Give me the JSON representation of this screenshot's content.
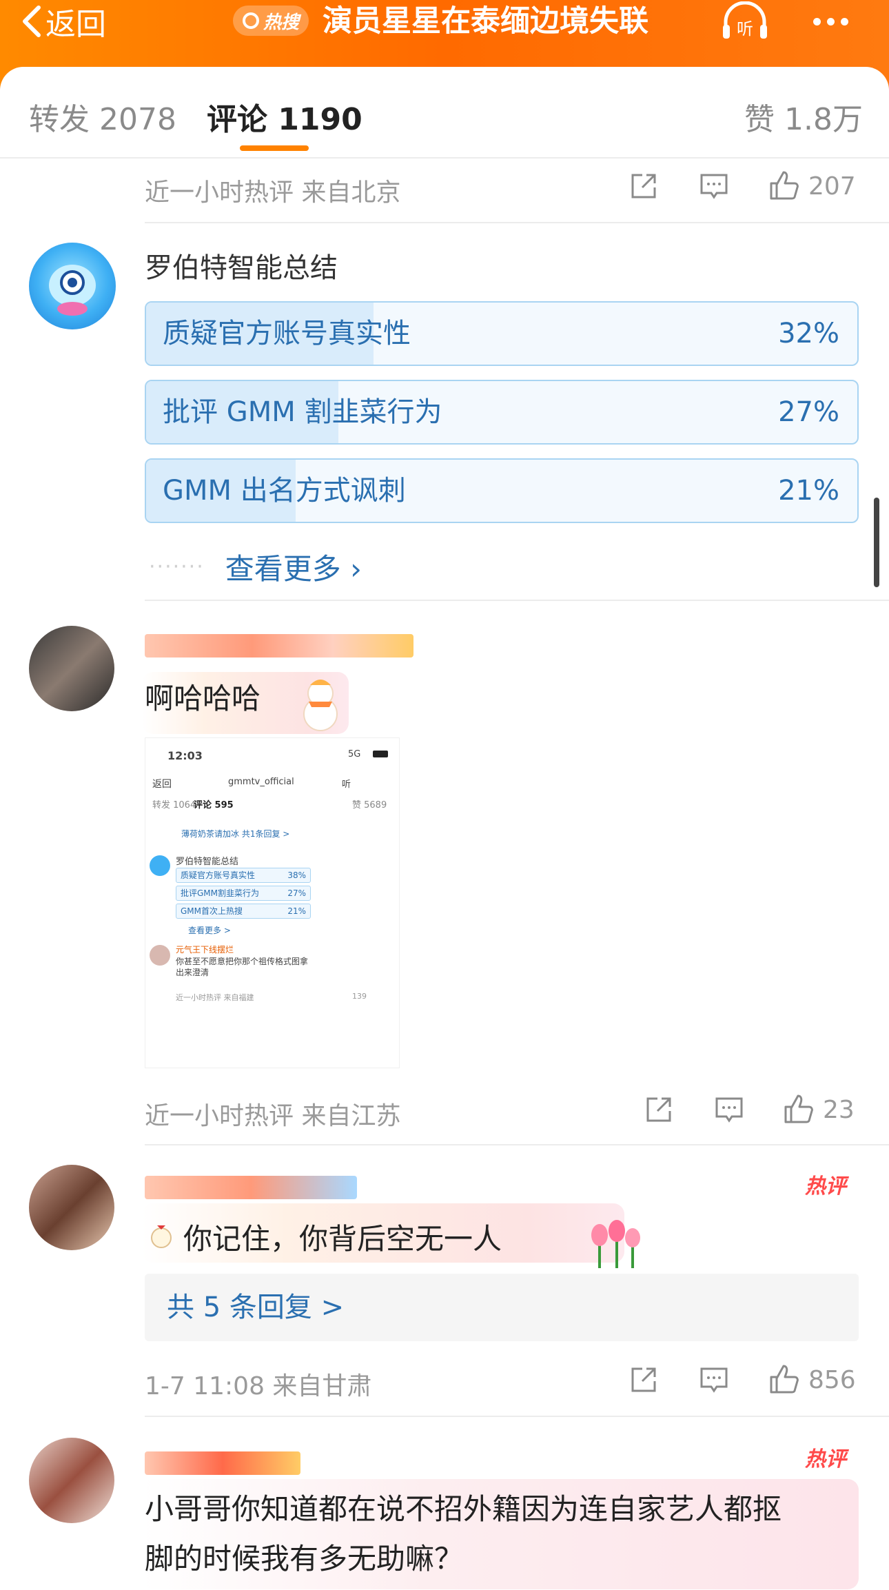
{
  "header": {
    "back_label": "返回",
    "hot_label": "热搜",
    "title": "演员星星在泰缅边境失联",
    "listen_label": "听"
  },
  "tabs": {
    "repost": "转发 2078",
    "comment": "评论 1190",
    "like": "赞 1.8万"
  },
  "top_comment": {
    "meta": "近一小时热评  来自北京",
    "likes": "207"
  },
  "ai_summary": {
    "title": "罗伯特智能总结",
    "items": [
      {
        "label": "质疑官方账号真实性",
        "percent": "32%",
        "value": 32
      },
      {
        "label": "批评 GMM 割韭菜行为",
        "percent": "27%",
        "value": 27
      },
      {
        "label": "GMM 出名方式讽刺",
        "percent": "21%",
        "value": 21
      }
    ],
    "see_more": "查看更多 ›"
  },
  "comment1": {
    "text": "啊哈哈哈",
    "meta": "近一小时热评  来自江苏",
    "likes": "23",
    "screenshot": {
      "time": "12:03",
      "signal": "5G",
      "back": "返回",
      "account": "gmmtv_official",
      "listen": "听",
      "tabs": [
        "转发 1064",
        "评论 595",
        "赞 5689"
      ],
      "reply_hint": "薄荷奶茶请加冰 共1条回复 >",
      "ai_title": "罗伯特智能总结",
      "items": [
        {
          "label": "质疑官方账号真实性",
          "pct": "38%"
        },
        {
          "label": "批评GMM割韭菜行为",
          "pct": "27%"
        },
        {
          "label": "GMM首次上热搜",
          "pct": "21%"
        }
      ],
      "see_more": "查看更多 >",
      "user": "元气王下线摆烂",
      "comment": "你甚至不愿意把你那个祖传格式图拿出来澄清",
      "meta": "近一小时热评  来自福建",
      "likes": "139"
    }
  },
  "comment2": {
    "hot": "热评",
    "text": "你记住，你背后空无一人",
    "replies": "共 5 条回复 >",
    "meta": "1-7 11:08  来自甘肃",
    "likes": "856"
  },
  "comment3": {
    "hot": "热评",
    "text_line1": "小哥哥你知道都在说不招外籍因为连自家艺人都抠",
    "text_line2": "脚的时候我有多无助嘛？"
  }
}
